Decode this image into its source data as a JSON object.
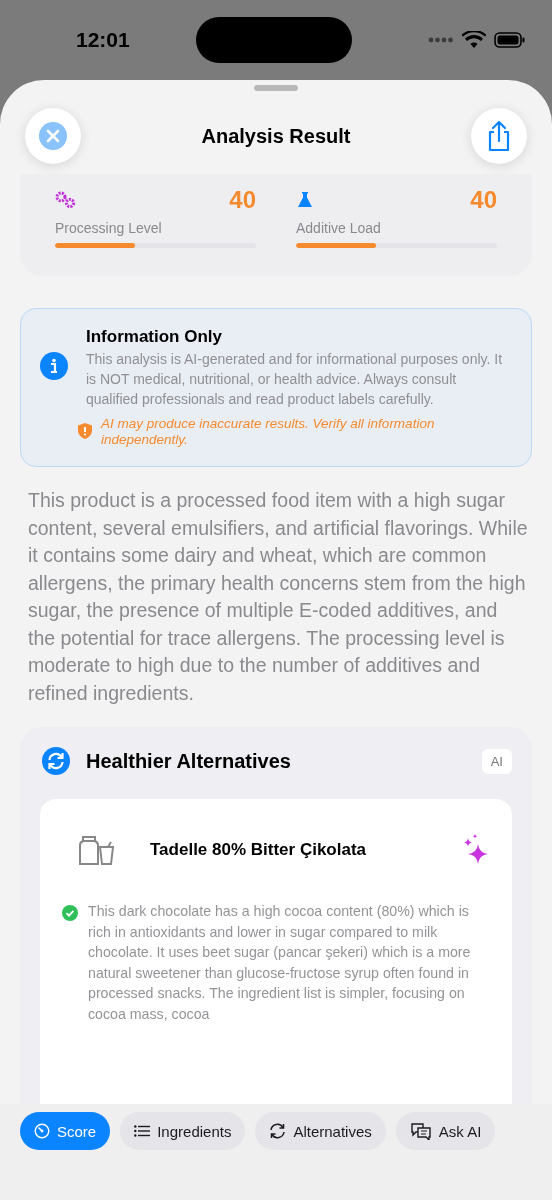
{
  "status_bar": {
    "time": "12:01"
  },
  "header": {
    "title": "Analysis Result"
  },
  "scores": [
    {
      "kind": "gears",
      "value": "40",
      "label": "Processing Level",
      "level": 0.4
    },
    {
      "kind": "flask",
      "value": "40",
      "label": "Additive Load",
      "level": 0.4
    }
  ],
  "notice": {
    "title": "Information Only",
    "body": "This analysis is AI-generated and for informational purposes only. It is NOT medical, nutritional, or health advice. Always consult qualified professionals and read product labels carefully.",
    "warning": "AI may produce inaccurate results. Verify all information independently."
  },
  "summary": "This product is a processed food item with a high sugar content, several emulsifiers, and artificial flavorings. While it contains some dairy and wheat, which are common allergens, the primary health concerns stem from the high sugar, the presence of multiple E-coded additives, and the potential for trace allergens. The processing level is moderate to high due to the number of additives and refined ingredients.",
  "alternatives": {
    "title": "Healthier Alternatives",
    "badge": "AI",
    "items": [
      {
        "name": "Tadelle 80% Bitter Çikolata",
        "reason": "This dark chocolate has a high cocoa content (80%) which is rich in antioxidants and lower in sugar compared to milk chocolate. It uses beet sugar (pancar şekeri) which is a more natural sweetener than glucose-fructose syrup often found in processed snacks. The ingredient list is simpler, focusing on cocoa mass, cocoa"
      }
    ]
  },
  "tabs": [
    {
      "kind": "score",
      "label": "Score",
      "selected": true
    },
    {
      "kind": "list",
      "label": "Ingredients",
      "selected": false
    },
    {
      "kind": "cycle",
      "label": "Alternatives",
      "selected": false
    },
    {
      "kind": "chat",
      "label": "Ask AI",
      "selected": false
    }
  ]
}
